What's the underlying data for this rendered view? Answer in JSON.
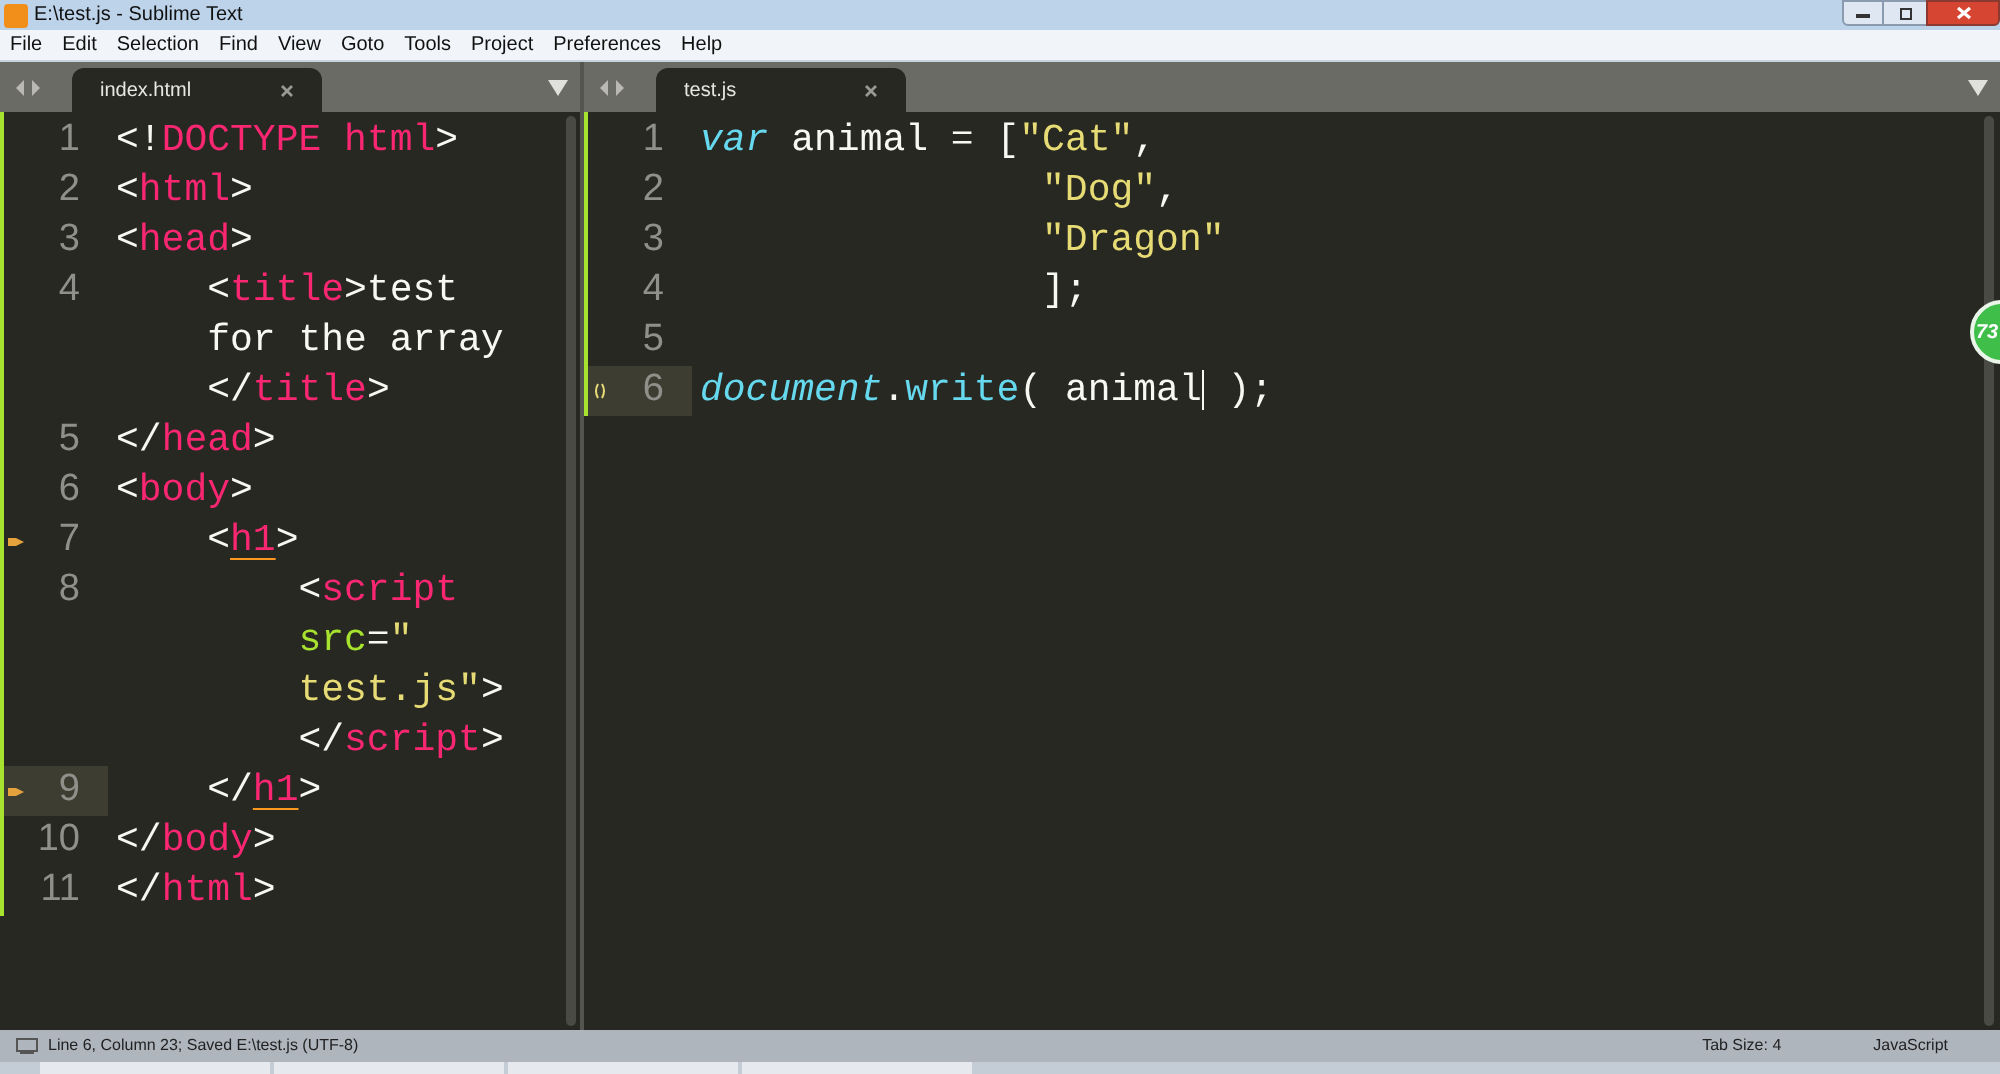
{
  "window": {
    "title": "E:\\test.js - Sublime Text"
  },
  "menu": [
    "File",
    "Edit",
    "Selection",
    "Find",
    "View",
    "Goto",
    "Tools",
    "Project",
    "Preferences",
    "Help"
  ],
  "panes": [
    {
      "tab": {
        "label": "index.html",
        "selected": true
      },
      "lines": [
        {
          "number": "1",
          "tokens": [
            {
              "kind": "punct",
              "text": "<!"
            },
            {
              "kind": "tag",
              "text": "DOCTYPE"
            },
            {
              "kind": "tag",
              "text": " html"
            },
            {
              "kind": "punct",
              "text": ">"
            }
          ]
        },
        {
          "number": "2",
          "tokens": [
            {
              "kind": "punct",
              "text": "<"
            },
            {
              "kind": "tag",
              "text": "html"
            },
            {
              "kind": "punct",
              "text": ">"
            }
          ]
        },
        {
          "number": "3",
          "tokens": [
            {
              "kind": "punct",
              "text": "<"
            },
            {
              "kind": "tag",
              "text": "head"
            },
            {
              "kind": "punct",
              "text": ">"
            }
          ]
        },
        {
          "number": "4",
          "tokens": [
            {
              "kind": "punct",
              "text": "    <"
            },
            {
              "kind": "tag",
              "text": "title"
            },
            {
              "kind": "punct",
              "text": ">test"
            }
          ]
        },
        {
          "tokens": [
            {
              "kind": "punct",
              "text": "    for the array"
            }
          ]
        },
        {
          "tokens": [
            {
              "kind": "punct",
              "text": "    </"
            },
            {
              "kind": "tag",
              "text": "title"
            },
            {
              "kind": "punct",
              "text": ">"
            }
          ]
        },
        {
          "number": "5",
          "tokens": [
            {
              "kind": "punct",
              "text": "</"
            },
            {
              "kind": "tag",
              "text": "head"
            },
            {
              "kind": "punct",
              "text": ">"
            }
          ]
        },
        {
          "number": "6",
          "tokens": [
            {
              "kind": "punct",
              "text": "<"
            },
            {
              "kind": "tag",
              "text": "body"
            },
            {
              "kind": "punct",
              "text": ">"
            }
          ]
        },
        {
          "number": "7",
          "marker": true,
          "tokens": [
            {
              "kind": "punct",
              "text": "    <"
            },
            {
              "kind": "tag",
              "text": "h1",
              "underline": true
            },
            {
              "kind": "punct",
              "text": ">"
            }
          ]
        },
        {
          "number": "8",
          "tokens": [
            {
              "kind": "punct",
              "text": "        <"
            },
            {
              "kind": "tag",
              "text": "script"
            }
          ]
        },
        {
          "tokens": [
            {
              "kind": "attr",
              "text": "        src"
            },
            {
              "kind": "punct",
              "text": "="
            },
            {
              "kind": "string",
              "text": "\""
            }
          ]
        },
        {
          "tokens": [
            {
              "kind": "string",
              "text": "        test.js\""
            },
            {
              "kind": "punct",
              "text": ">"
            }
          ]
        },
        {
          "tokens": [
            {
              "kind": "punct",
              "text": "        </"
            },
            {
              "kind": "tag",
              "text": "script"
            },
            {
              "kind": "punct",
              "text": ">"
            }
          ]
        },
        {
          "number": "9",
          "marker": true,
          "current": true,
          "tokens": [
            {
              "kind": "punct",
              "text": "    </"
            },
            {
              "kind": "tag",
              "text": "h1",
              "underline": true
            },
            {
              "kind": "punct",
              "text": ">"
            }
          ]
        },
        {
          "number": "10",
          "tokens": [
            {
              "kind": "punct",
              "text": "</"
            },
            {
              "kind": "tag",
              "text": "body"
            },
            {
              "kind": "punct",
              "text": ">"
            }
          ]
        },
        {
          "number": "11",
          "tokens": [
            {
              "kind": "punct",
              "text": "</"
            },
            {
              "kind": "tag",
              "text": "html"
            },
            {
              "kind": "punct",
              "text": ">"
            }
          ]
        }
      ]
    },
    {
      "tab": {
        "label": "test.js",
        "selected": true
      },
      "lines": [
        {
          "number": "1",
          "tokens": [
            {
              "kind": "keyword",
              "text": "var"
            },
            {
              "kind": "punct",
              "text": " animal = ["
            },
            {
              "kind": "string",
              "text": "\"Cat\""
            },
            {
              "kind": "punct",
              "text": ","
            }
          ]
        },
        {
          "number": "2",
          "tokens": [
            {
              "kind": "string",
              "text": "               \"Dog\""
            },
            {
              "kind": "punct",
              "text": ","
            }
          ]
        },
        {
          "number": "3",
          "tokens": [
            {
              "kind": "string",
              "text": "               \"Dragon\""
            }
          ]
        },
        {
          "number": "4",
          "tokens": [
            {
              "kind": "punct",
              "text": "               ];"
            }
          ]
        },
        {
          "number": "5"
        },
        {
          "number": "6",
          "current": true,
          "bracket_mark": true,
          "tokens": [
            {
              "kind": "keyword",
              "text": "document"
            },
            {
              "kind": "punct",
              "text": "."
            },
            {
              "kind": "function",
              "text": "write"
            },
            {
              "kind": "punct",
              "text": "( animal",
              "caret_after": true
            },
            {
              "kind": "punct",
              "text": " );"
            }
          ]
        }
      ]
    }
  ],
  "status_bar": {
    "position": "Line 6, Column 23; Saved E:\\test.js (UTF-8)",
    "tab_size": "Tab Size: 4",
    "syntax": "JavaScript"
  },
  "badge": "73"
}
